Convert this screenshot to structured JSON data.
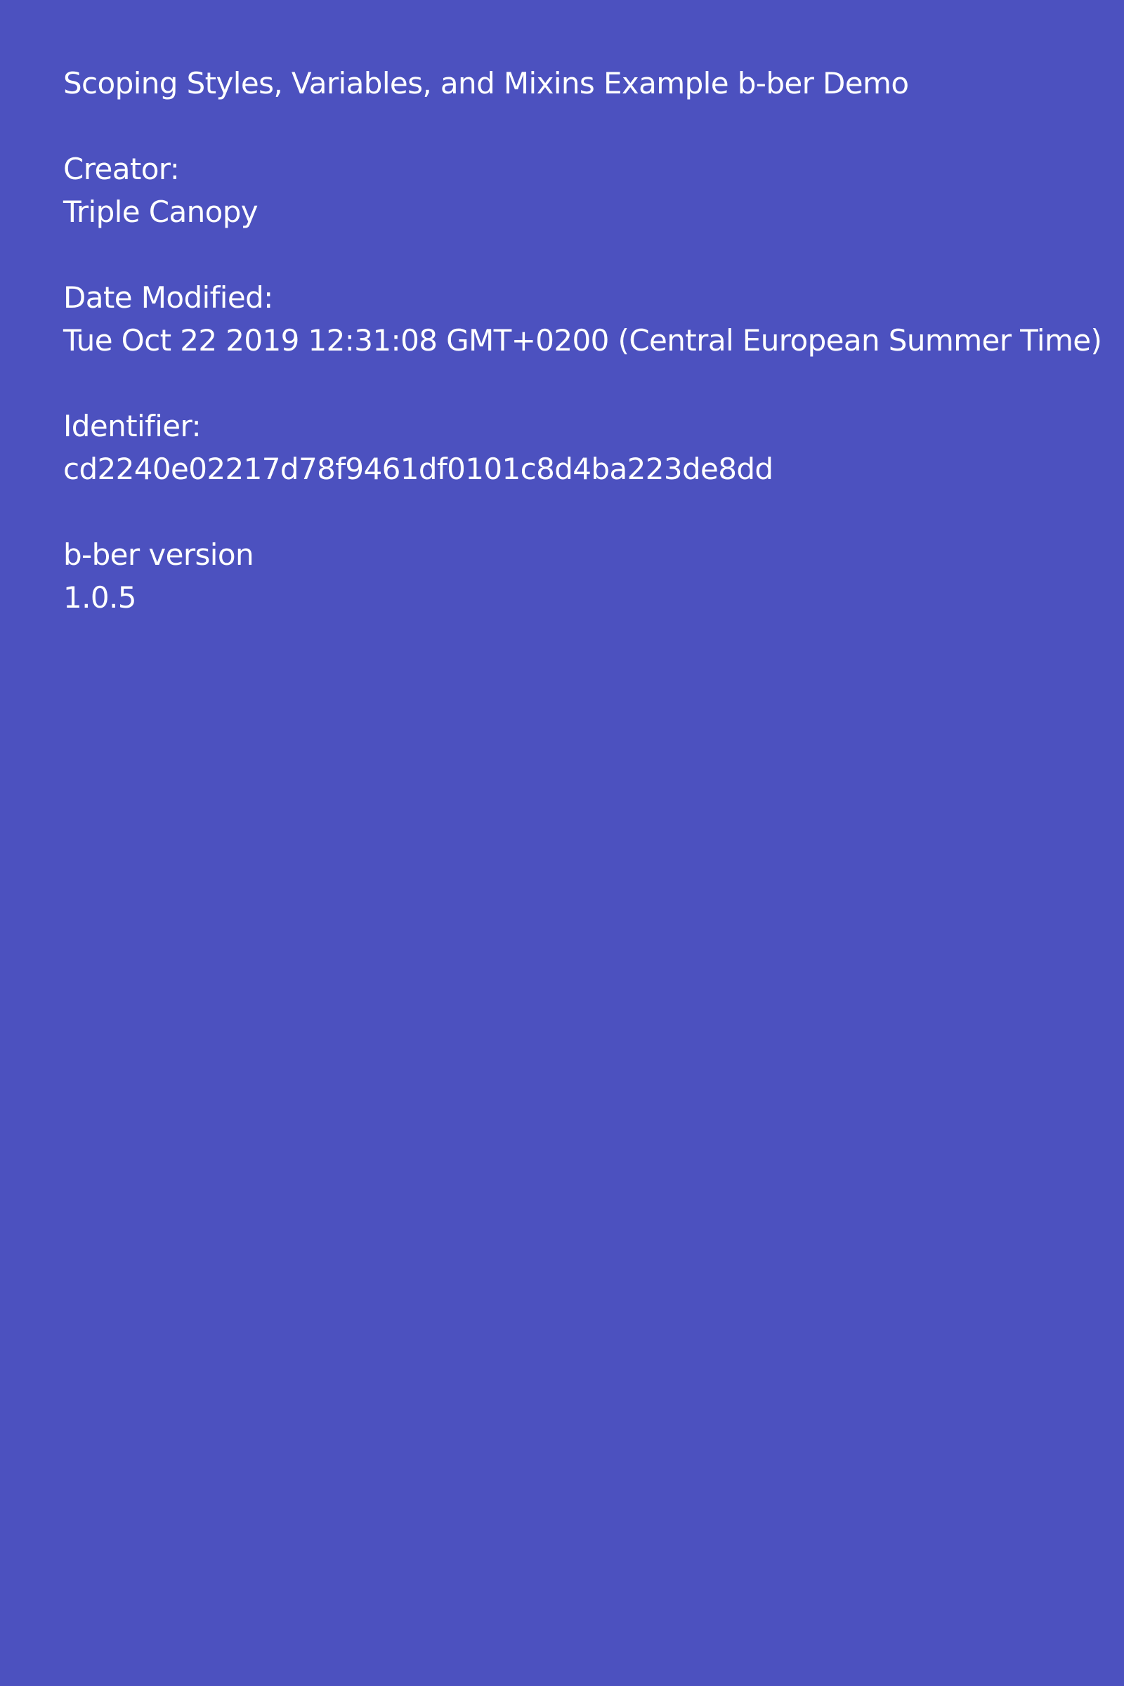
{
  "document": {
    "title": "Scoping Styles, Variables, and Mixins Example b-ber Demo",
    "fields": [
      {
        "label": "Creator:",
        "value": "Triple Canopy"
      },
      {
        "label": "Date Modified:",
        "value": "Tue Oct 22 2019 12:31:08 GMT+0200 (Central European Summer Time)"
      },
      {
        "label": "Identifier:",
        "value": "cd2240e02217d78f9461df0101c8d4ba223de8dd"
      },
      {
        "label": "b-ber version",
        "value": "1.0.5"
      }
    ]
  },
  "colors": {
    "background": "#4c51bf",
    "text": "#ffffff"
  }
}
